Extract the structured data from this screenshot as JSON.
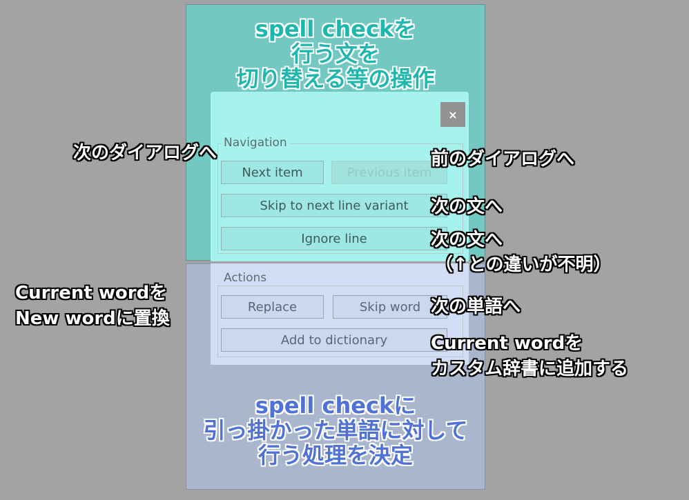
{
  "headings": {
    "top": [
      "spell checkを",
      "行う文を",
      "切り替える等の操作"
    ],
    "bottom": [
      "spell checkに",
      "引っ掛かった単語に対して",
      "行う処理を決定"
    ]
  },
  "dialog": {
    "close_label": "×",
    "navigation": {
      "label": "Navigation",
      "next_item": "Next item",
      "previous_item": "Previous item",
      "skip_line_variant": "Skip to next line variant",
      "ignore_line": "Ignore line"
    },
    "actions": {
      "label": "Actions",
      "replace": "Replace",
      "skip_word": "Skip word",
      "add_to_dictionary": "Add to dictionary"
    }
  },
  "annotations": {
    "next_dialog": "次のダイアログへ",
    "prev_dialog": "前のダイアログへ",
    "next_sentence_1": "次の文へ",
    "next_sentence_2": "次の文へ",
    "difference_unknown": "（↑との違いが不明）",
    "replace_note_1": "Current wordを",
    "replace_note_2": "New wordに置換",
    "next_word": "次の単語へ",
    "add_note_1": "Current wordを",
    "add_note_2": "カスタム辞書に追加する"
  },
  "colors": {
    "top_overlay": "#74c8c2",
    "bottom_overlay": "#a9b6cd",
    "top_heading": "#1fb7ad",
    "bottom_heading": "#4f72d4"
  }
}
